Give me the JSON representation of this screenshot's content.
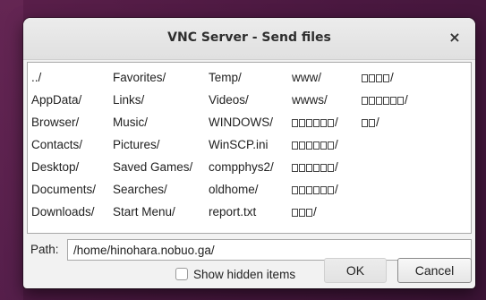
{
  "window": {
    "title": "VNC Server - Send files",
    "close_glyph": "×"
  },
  "file_list": {
    "columns": [
      [
        {
          "name": "../"
        },
        {
          "name": "AppData/"
        },
        {
          "name": "Browser/"
        },
        {
          "name": "Contacts/"
        },
        {
          "name": "Desktop/"
        },
        {
          "name": "Documents/"
        },
        {
          "name": "Downloads/"
        }
      ],
      [
        {
          "name": "Favorites/"
        },
        {
          "name": "Links/"
        },
        {
          "name": "Music/"
        },
        {
          "name": "Pictures/"
        },
        {
          "name": "Saved Games/"
        },
        {
          "name": "Searches/"
        },
        {
          "name": "Start Menu/"
        }
      ],
      [
        {
          "name": "Temp/"
        },
        {
          "name": "Videos/"
        },
        {
          "name": "WINDOWS/"
        },
        {
          "name": "WinSCP.ini"
        },
        {
          "name": "compphys2/"
        },
        {
          "name": "oldhome/"
        },
        {
          "name": "report.txt"
        }
      ],
      [
        {
          "name": "www/"
        },
        {
          "name": "wwws/"
        },
        {
          "name": "",
          "missing_glyphs": 6,
          "suffix": "/"
        },
        {
          "name": "",
          "missing_glyphs": 6,
          "suffix": "/"
        },
        {
          "name": "",
          "missing_glyphs": 6,
          "suffix": "/"
        },
        {
          "name": "",
          "missing_glyphs": 6,
          "suffix": "/"
        },
        {
          "name": "",
          "missing_glyphs": 3,
          "suffix": "/"
        }
      ],
      [
        {
          "name": "",
          "missing_glyphs": 4,
          "suffix": "/"
        },
        {
          "name": "",
          "missing_glyphs": 6,
          "suffix": "/"
        },
        {
          "name": "",
          "missing_glyphs": 2,
          "suffix": "/"
        }
      ]
    ]
  },
  "path": {
    "label": "Path:",
    "value": "/home/hinohara.nobuo.ga/"
  },
  "options": {
    "show_hidden_label": "Show hidden items",
    "show_hidden_checked": false
  },
  "buttons": {
    "ok_label": "OK",
    "cancel_label": "Cancel"
  }
}
